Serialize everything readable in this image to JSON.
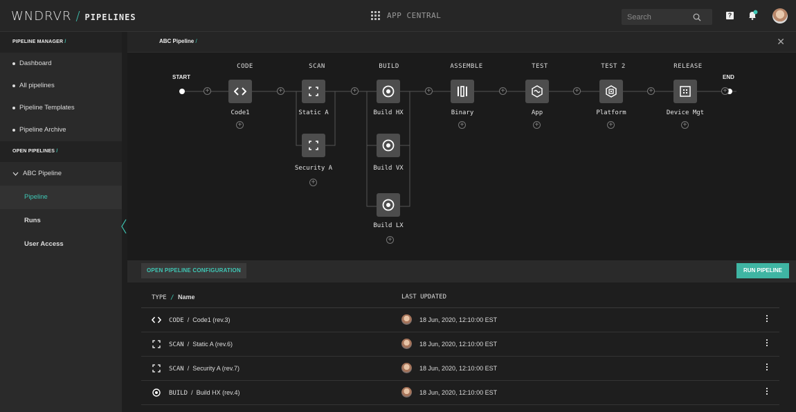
{
  "header": {
    "brand": "WNDRVR",
    "brand_sep": "/",
    "section": "PIPELINES",
    "app_central": "APP CENTRAL",
    "search_placeholder": "Search",
    "help_label": "?"
  },
  "sidebar": {
    "manager_title": "PIPELINE MANAGER",
    "manager_sep": "/",
    "items": [
      {
        "label": "Dashboard"
      },
      {
        "label": "All pipelines"
      },
      {
        "label": "Pipeline Templates"
      },
      {
        "label": "Pipeline Archive"
      }
    ],
    "open_title": "OPEN PIPELINES",
    "open_sep": "/",
    "open_pipeline": "ABC Pipeline",
    "sub_items": [
      {
        "label": "Pipeline",
        "active": true
      },
      {
        "label": "Runs"
      },
      {
        "label": "User Access"
      }
    ]
  },
  "breadcrumb": {
    "label": "ABC Pipeline",
    "sep": "/"
  },
  "pipeline": {
    "start_label": "START",
    "end_label": "END",
    "stages": [
      {
        "title": "CODE",
        "nodes": [
          "Code1"
        ]
      },
      {
        "title": "SCAN",
        "nodes": [
          "Static A",
          "Security A"
        ]
      },
      {
        "title": "BUILD",
        "nodes": [
          "Build HX",
          "Build VX",
          "Build LX"
        ]
      },
      {
        "title": "ASSEMBLE",
        "nodes": [
          "Binary"
        ]
      },
      {
        "title": "TEST",
        "nodes": [
          "App"
        ]
      },
      {
        "title": "TEST 2",
        "nodes": [
          "Platform"
        ]
      },
      {
        "title": "RELEASE",
        "nodes": [
          "Device Mgt"
        ]
      }
    ]
  },
  "actions": {
    "config_label": "OPEN PIPELINE CONFIGURATION",
    "run_label": "RUN PIPELINE"
  },
  "table": {
    "col_type": "TYPE",
    "col_sep": "/",
    "col_name": "Name",
    "col_updated": "LAST UPDATED",
    "rows": [
      {
        "icon": "code-icon",
        "type": "CODE",
        "name": "Code1 (rev.3)",
        "updated": "18 Jun, 2020, 12:10:00 EST"
      },
      {
        "icon": "scan-icon",
        "type": "SCAN",
        "name": "Static A (rev.6)",
        "updated": "18 Jun, 2020, 12:10:00 EST"
      },
      {
        "icon": "scan-icon",
        "type": "SCAN",
        "name": "Security A (rev.7)",
        "updated": "18 Jun, 2020, 12:10:00 EST"
      },
      {
        "icon": "build-icon",
        "type": "BUILD",
        "name": "Build HX (rev.4)",
        "updated": "18 Jun, 2020, 12:10:00 EST"
      }
    ]
  },
  "colors": {
    "accent": "#3fc7b5",
    "run_button": "#3fb5a3",
    "background": "#1e1e1e"
  }
}
